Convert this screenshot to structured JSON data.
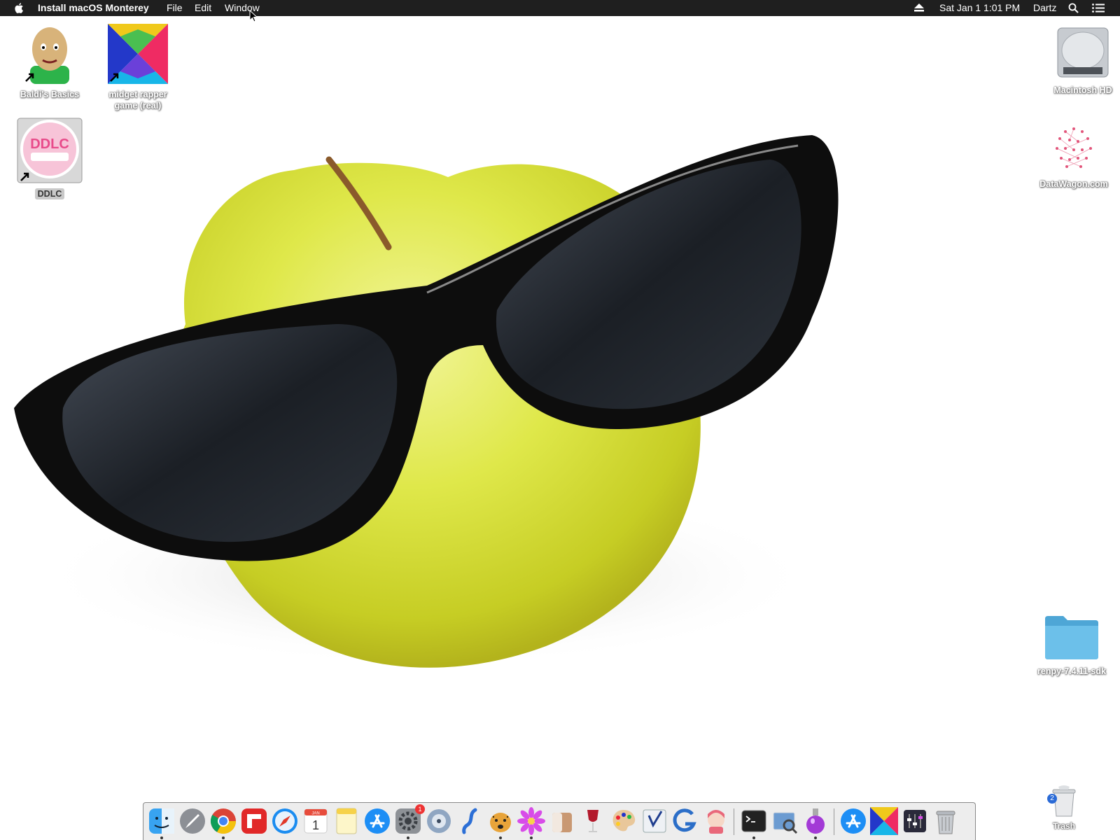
{
  "menubar": {
    "app_name": "Install macOS Monterey",
    "items": [
      "File",
      "Edit",
      "Window"
    ],
    "datetime": "Sat Jan 1  1:01 PM",
    "user": "Dartz"
  },
  "desktop": {
    "icons": [
      {
        "label": "Baldi's Basics",
        "icon": "baldi-app-icon"
      },
      {
        "label": "midget rapper game (real)",
        "icon": "colorful-x-app-icon"
      },
      {
        "label": "DDLC",
        "icon": "ddlc-app-icon",
        "selected": true
      },
      {
        "label": "Macintosh HD",
        "icon": "hard-drive-icon"
      },
      {
        "label": "DataWagon.com",
        "icon": "datawagon-icon"
      },
      {
        "label": "renpy-7.4.11-sdk",
        "icon": "folder-icon"
      }
    ],
    "trash": {
      "label": "Trash",
      "badge": "2"
    }
  },
  "dock": {
    "apps": [
      {
        "name": "finder-icon",
        "running": true
      },
      {
        "name": "launchpad-icon",
        "running": false
      },
      {
        "name": "chrome-icon",
        "running": true
      },
      {
        "name": "flipboard-icon",
        "running": false
      },
      {
        "name": "safari-icon",
        "running": false
      },
      {
        "name": "calendar-icon",
        "running": false,
        "text": "JAN",
        "day": "1"
      },
      {
        "name": "notes-icon",
        "running": false
      },
      {
        "name": "app-store-icon",
        "running": false
      },
      {
        "name": "system-preferences-icon",
        "running": true,
        "badge": "1"
      },
      {
        "name": "disk-utility-icon",
        "running": false
      },
      {
        "name": "steam-like-icon",
        "running": false
      },
      {
        "name": "cheetah-icon",
        "running": true
      },
      {
        "name": "flower-icon",
        "running": true
      },
      {
        "name": "cube-icon",
        "running": false
      },
      {
        "name": "wine-icon",
        "running": false
      },
      {
        "name": "paint-palette-icon",
        "running": false
      },
      {
        "name": "checklist-icon",
        "running": false
      },
      {
        "name": "gog-galaxy-icon",
        "running": false
      },
      {
        "name": "anime-character-icon",
        "running": false
      },
      {
        "name": "terminal-icon",
        "running": true
      },
      {
        "name": "preview-icon",
        "running": false
      },
      {
        "name": "potion-icon",
        "running": true
      },
      {
        "name": "app-store-download-icon",
        "running": false
      },
      {
        "name": "colorful-x-icon",
        "running": false
      },
      {
        "name": "audio-mixer-icon",
        "running": false
      },
      {
        "name": "dock-trash-icon",
        "running": false
      }
    ]
  },
  "colors": {
    "menubar_bg": "#1f1f1f",
    "apple_fill": "#d4e23a",
    "glasses": "#0d0d0d",
    "folder": "#5fb7e4"
  }
}
